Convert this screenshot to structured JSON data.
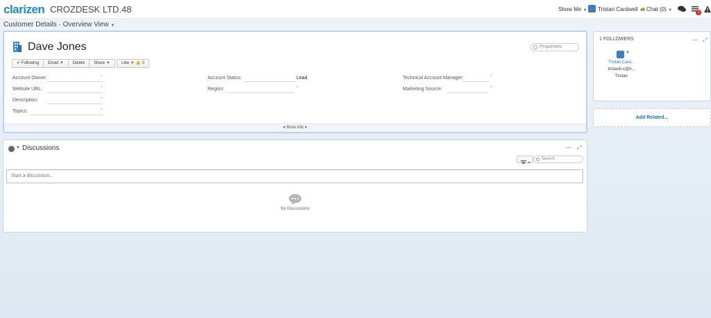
{
  "header": {
    "logo": "clarizen",
    "company": "CROZDESK LTD.48",
    "show_me": "Show Me",
    "user_name": "Tristan Cardwell",
    "chat": "Chat (0)",
    "notification_count": "1"
  },
  "breadcrumb": {
    "customer_details": "Customer Details",
    "separator": "·",
    "overview_view": "Overview View"
  },
  "entity": {
    "name": "Dave Jones",
    "properties_placeholder": "Properties"
  },
  "toolbar": {
    "following": "Following",
    "email": "Email",
    "delete": "Delete",
    "share": "Share",
    "like": "Like",
    "like_count": "0"
  },
  "fields": {
    "account_owner": "Account Owner:",
    "website_url": "Website URL:",
    "description": "Description:",
    "topics": "Topics:",
    "account_status": "Account Status:",
    "account_status_value": "Lead",
    "region": "Region:",
    "technical_account_manager": "Technical Account Manager:",
    "marketing_source": "Marketing Source:",
    "required_marker": "*"
  },
  "more_info": "▾ More info ▾",
  "discussions": {
    "title": "Discussions",
    "search_placeholder": "Search",
    "input_placeholder": "Start a discussion...",
    "empty_text": "No Discussions"
  },
  "followers": {
    "title": "1 FOLLOWERS",
    "name": "Tristan Card...",
    "email": "tristanh-c@h...",
    "first_name": "Tristan"
  },
  "related": {
    "add": "Add Related..."
  },
  "window_controls": {
    "minimize": "—",
    "expand": "⤢"
  },
  "colors": {
    "brand": "#1f8ac9",
    "link": "#1f6fb5",
    "panel_border": "#b9d3ec"
  }
}
